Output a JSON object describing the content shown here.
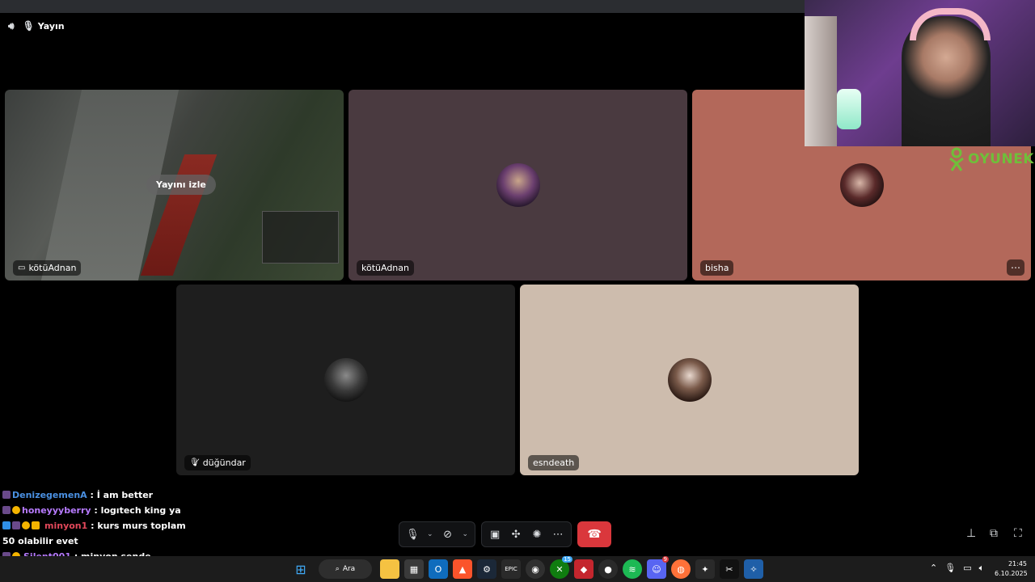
{
  "header": {
    "stream_title": "Yayın"
  },
  "tiles": [
    {
      "name": "kötüAdnan",
      "type": "stream",
      "watch_label": "Yayını izle"
    },
    {
      "name": "kötüAdnan",
      "type": "avatar"
    },
    {
      "name": "bisha",
      "type": "avatar",
      "more": "⋯"
    },
    {
      "name": "düğündar",
      "type": "avatar",
      "muted": true
    },
    {
      "name": "esndeath",
      "type": "avatar"
    }
  ],
  "brand": {
    "text": "OYUNEKS",
    "color": "#6fbf3a"
  },
  "chat": [
    {
      "user": "DenizegemenA",
      "user_color": "#4a90e2",
      "text": " : İ am better"
    },
    {
      "user": "honeyyyberry",
      "user_color": "#b77bff",
      "text": " : logıtech king ya"
    },
    {
      "user": "minyon1",
      "user_color": "#e2485a",
      "text": " : kurs murs toplam 50 olabilir evet"
    },
    {
      "user": "Silent001",
      "user_color": "#b77bff",
      "text": " : minyon sende gitsene"
    }
  ],
  "taskbar": {
    "search_label": "Ara",
    "badges": {
      "xbox": "15",
      "discord": "9"
    },
    "time": "21:45",
    "date": "6.10.2025"
  },
  "colors": {
    "hangup": "#da373c",
    "accent_discord": "#5865f2"
  }
}
